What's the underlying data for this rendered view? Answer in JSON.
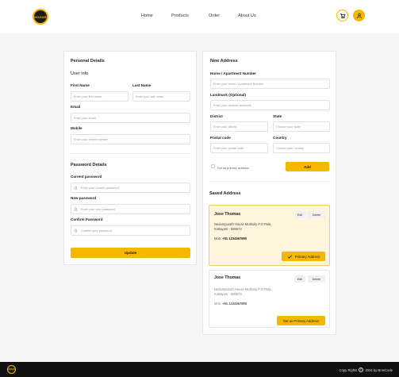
{
  "brand": {
    "logo_text": "HOGAR",
    "accent": "#f5b800"
  },
  "nav": {
    "links": [
      "Home",
      "Products",
      "Order",
      "About Us"
    ],
    "cart_icon": "cart-icon",
    "user_icon": "user-icon"
  },
  "personal": {
    "title": "Personal Details",
    "user_info": "User Info",
    "first_name": {
      "label": "First Name",
      "placeholder": "Enter your first name"
    },
    "last_name": {
      "label": "Last Name",
      "placeholder": "Enter your last name"
    },
    "email": {
      "label": "Email",
      "placeholder": "Enter your email"
    },
    "mobile": {
      "label": "Mobile",
      "placeholder": "Enter your phone number"
    },
    "password_title": "Password Details",
    "current_password": {
      "label": "Current password",
      "placeholder": "Enter your current password"
    },
    "new_password": {
      "label": "New password",
      "placeholder": "Enter your new password"
    },
    "confirm_password": {
      "label": "Confirm Password",
      "placeholder": "Confirm your password"
    },
    "update_button": "Update"
  },
  "address": {
    "title": "New Address",
    "home": {
      "label": "Home / Apartment Number",
      "placeholder": "Enter your home / Apartment Number"
    },
    "landmark": {
      "label": "Landmark (Optional)",
      "placeholder": "Enter your nearest landmark"
    },
    "district": {
      "label": "District",
      "placeholder": "Enter your district"
    },
    "state": {
      "label": "State",
      "placeholder": "Choose your state"
    },
    "postal": {
      "label": "Postal code",
      "placeholder": "Enter your postal code"
    },
    "country": {
      "label": "Country",
      "placeholder": "Choose your country"
    },
    "primary_checkbox_label": "Set as primary address",
    "add_button": "Add",
    "saved_title": "Saved Address",
    "saved": [
      {
        "name": "Jose Thomas",
        "address_line1": "Nedumpurath House Muthoily P.O Pala,",
        "address_line2": "Kottayam - 686573",
        "mob_label": "Mob:",
        "mob_value": "+91 1234567890",
        "edit": "Edit",
        "delete": "Delete",
        "action": "Primary Address"
      },
      {
        "name": "Jose Thomas",
        "address_line1": "Nedumpurath House Muthoily P.O Pala,",
        "address_line2": "Kottayam - 686573",
        "mob_label": "Mob:",
        "mob_value": "+91 1234567890",
        "edit": "Edit",
        "delete": "Delete",
        "action": "Set as Primary Address"
      }
    ]
  },
  "footer": {
    "copyright": "Copy Rights",
    "year_text": "2024 by BrosCode"
  }
}
